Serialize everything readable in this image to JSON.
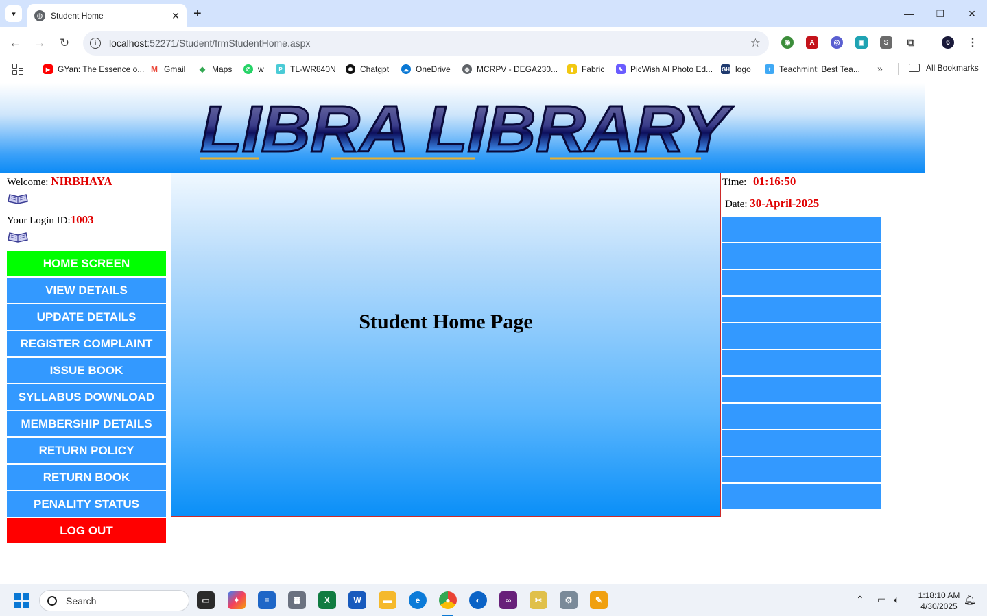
{
  "browser": {
    "tab_title": "Student Home",
    "tab_close": "✕",
    "new_tab": "+",
    "url_host": "localhost",
    "url_path": ":52271/Student/frmStudentHome.aspx",
    "bookmarks": [
      {
        "label": "GYan: The Essence o...",
        "icon": "youtube-icon",
        "color": "#ff0000"
      },
      {
        "label": "Gmail",
        "icon": "gmail-icon",
        "color": "#ea4335"
      },
      {
        "label": "Maps",
        "icon": "maps-icon",
        "color": "#34a853"
      },
      {
        "label": "w",
        "icon": "whatsapp-icon",
        "color": "#25d366"
      },
      {
        "label": "TL-WR840N",
        "icon": "tplink-icon",
        "color": "#4acbd6"
      },
      {
        "label": "Chatgpt",
        "icon": "chatgpt-icon",
        "color": "#111111"
      },
      {
        "label": "OneDrive",
        "icon": "onedrive-icon",
        "color": "#0a78d4"
      },
      {
        "label": "MCRPV - DEGA230...",
        "icon": "globe-icon",
        "color": "#5f6368"
      },
      {
        "label": "Fabric",
        "icon": "fabric-icon",
        "color": "#f2c811"
      },
      {
        "label": "PicWish AI Photo Ed...",
        "icon": "picwish-icon",
        "color": "#6a5cff"
      },
      {
        "label": "logo",
        "icon": "gh-icon",
        "color": "#1f3a6e"
      },
      {
        "label": "Teachmint: Best Tea...",
        "icon": "teachmint-icon",
        "color": "#3fa9f5"
      }
    ],
    "more_bookmarks": "»",
    "all_bookmarks": "All Bookmarks"
  },
  "page": {
    "welcome_label": "Welcome: ",
    "welcome_name": "NIRBHAYA",
    "login_label": "Your Login ID:",
    "login_id": "1003",
    "center_title": "Student Home Page",
    "time_label": "Time: ",
    "time_value": "01:16:50",
    "date_label": "Date: ",
    "date_value": "30-April-2025",
    "menu": [
      "HOME SCREEN",
      "VIEW DETAILS",
      "UPDATE DETAILS",
      "REGISTER COMPLAINT",
      "ISSUE BOOK",
      "SYLLABUS DOWNLOAD",
      "MEMBERSHIP DETAILS",
      "RETURN POLICY",
      "RETURN BOOK",
      "PENALITY STATUS",
      "LOG OUT"
    ],
    "banner_text": "LIBRA LIBRARY",
    "colors": {
      "accent_blue": "#3399ff",
      "home_green": "#00ff00",
      "logout_red": "#ff0000",
      "value_red": "#e00000"
    }
  },
  "taskbar": {
    "search_placeholder": "Search",
    "clock_time": "1:18:10 AM",
    "clock_date": "4/30/2025"
  }
}
